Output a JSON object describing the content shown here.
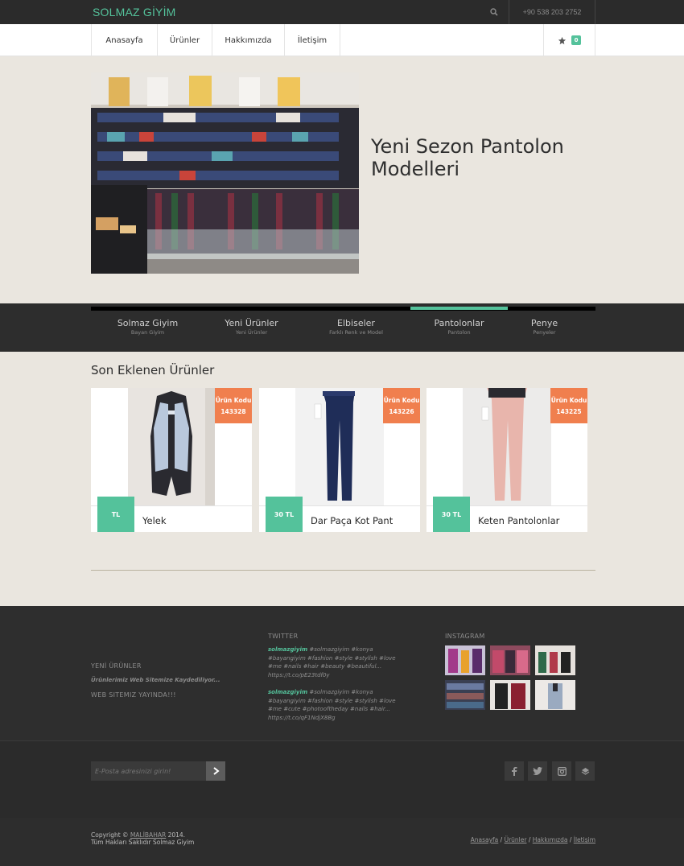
{
  "brand": "SOLMAZ GİYİM",
  "topbar": {
    "phone": "+90 538 203 2752",
    "search_icon": "search-icon"
  },
  "nav": {
    "items": [
      "Anasayfa",
      "Ürünler",
      "Hakkımızda",
      "İletişim"
    ],
    "cart_count": "0",
    "cart_icon": "star-icon"
  },
  "hero": {
    "title": "Yeni Sezon Pantolon Modelleri"
  },
  "categories": [
    {
      "title": "Solmaz Giyim",
      "sub": "Bayan Giyim"
    },
    {
      "title": "Yeni Ürünler",
      "sub": "Yeni Ürünler"
    },
    {
      "title": "Elbiseler",
      "sub": "Farklı Renk ve Model"
    },
    {
      "title": "Pantolonlar",
      "sub": "Pantolon",
      "active": true
    },
    {
      "title": "Penye",
      "sub": "Penyeler"
    }
  ],
  "products_section": {
    "title": "Son Eklenen Ürünler"
  },
  "products": [
    {
      "code_label": "Ürün Kodu",
      "code": "143328",
      "price": "TL",
      "name": "Yelek"
    },
    {
      "code_label": "Ürün Kodu",
      "code": "143226",
      "price": "30 TL",
      "name": "Dar Paça Kot Pant"
    },
    {
      "code_label": "Ürün Kodu",
      "code": "143225",
      "price": "30 TL",
      "name": "Keten Pantolonlar"
    }
  ],
  "footer": {
    "left_head": "YENİ ÜRÜNLER",
    "left_text": "Ürünlerimiz Web Sitemize Kaydediliyor...",
    "left_head2": "WEB SITEMIZ YAYINDA!!!",
    "twitter_head": "TWITTER",
    "tweets": [
      {
        "user": "solmazgiyim",
        "text": "#solmazgiyim #konya #bayangiyim #fashion #style #stylish #love #me #nails #hair #beauty #beautiful... https://t.co/pE23tdf0y"
      },
      {
        "user": "solmazgiyim",
        "text": "#solmazgiyim #konya #bayangiyim #fashion #style #stylish #love #me #cute #photooftheday #nails #hair... https://t.co/qF1NdjX8Bg"
      }
    ],
    "instagram_head": "INSTAGRAM",
    "newsletter_placeholder": "E-Posta adresinizi girin!",
    "social_icons": [
      "facebook-icon",
      "twitter-icon",
      "instagram-icon",
      "foursquare-icon"
    ],
    "copyright_prefix": "Copyright ©",
    "copyright_link": "MALİBAHAR",
    "copyright_year": "2014.",
    "copyright_line2": "Tüm Hakları Saklıdır Solmaz Giyim",
    "links": [
      "Anasayfa",
      "Ürünler",
      "Hakkımızda",
      "İletişim"
    ]
  }
}
